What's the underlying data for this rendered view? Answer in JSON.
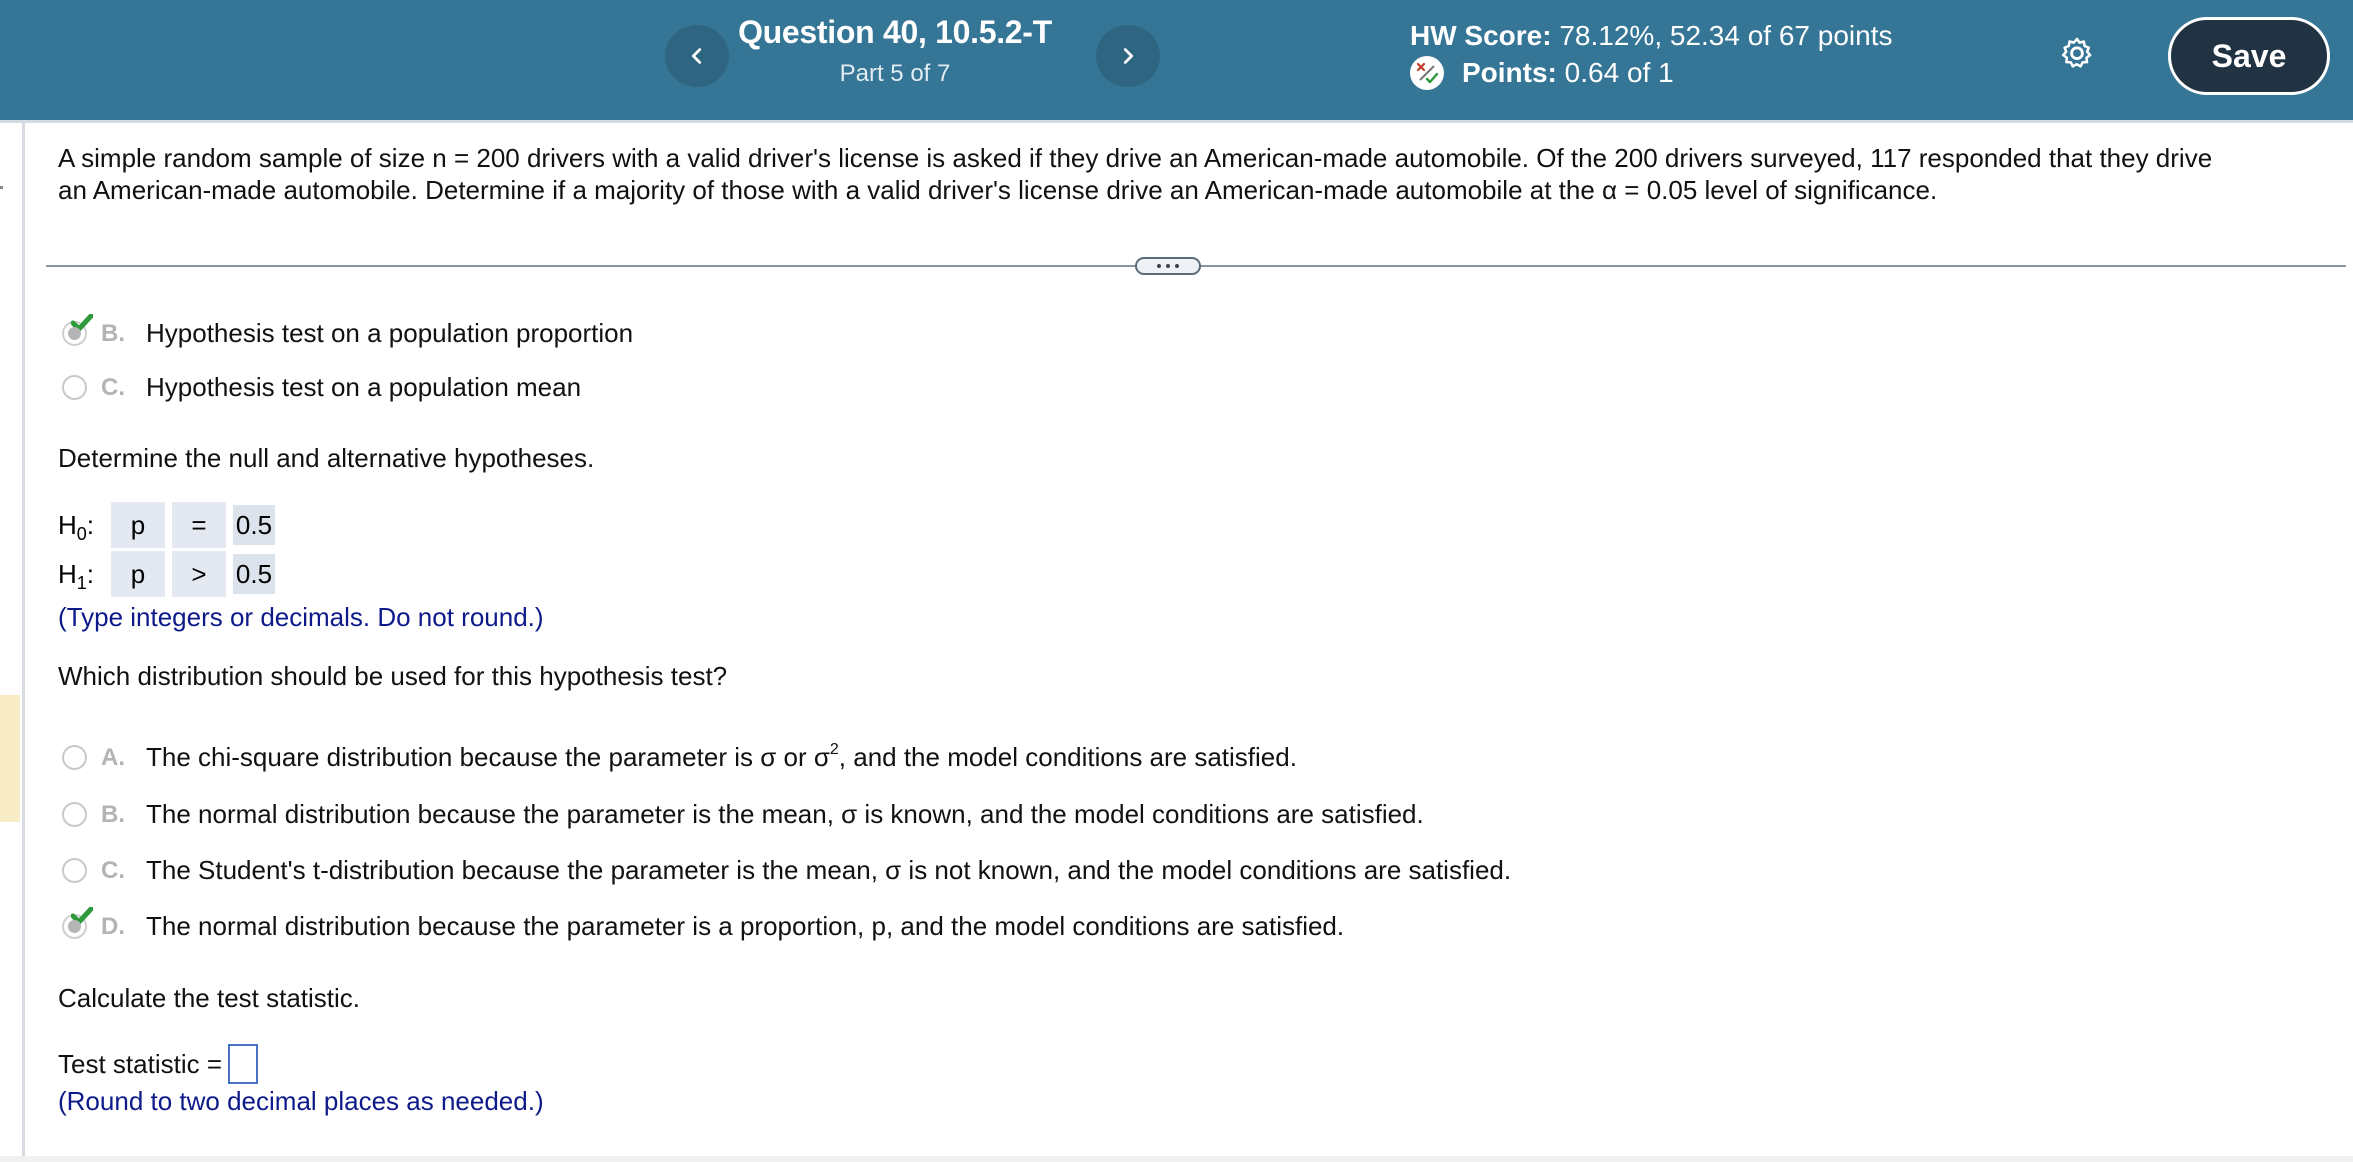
{
  "header": {
    "question_title": "Question 40, 10.5.2-T",
    "part": "Part 5 of 7",
    "hw_score_label": "HW Score:",
    "hw_score_value": "78.12%, 52.34 of 67 points",
    "points_label": "Points:",
    "points_value": "0.64 of 1",
    "save_label": "Save",
    "prev_icon": "chevron-left-icon",
    "next_icon": "chevron-right-icon",
    "settings_icon": "gear-icon",
    "points_status_icon": "partial-credit-icon"
  },
  "colors": {
    "header_bg": "#357596",
    "save_bg": "#213342",
    "hint_text": "#0e1a8a",
    "check_green": "#2e9a3b",
    "input_border": "#4a72c4"
  },
  "problem": {
    "line1": "A simple random sample of size n = 200 drivers with a valid driver's license is asked if they drive an American-made automobile. Of the 200 drivers surveyed, 117 responded that they drive",
    "line2": "an American-made automobile. Determine if a majority of those with a valid driver's license drive an American-made automobile at the α = 0.05 level of significance.",
    "more_button": "..."
  },
  "test_type": {
    "options": [
      {
        "letter": "B.",
        "text": "Hypothesis test on a population proportion",
        "selected": true,
        "correct": true
      },
      {
        "letter": "C.",
        "text": "Hypothesis test on a population mean",
        "selected": false,
        "correct": false
      }
    ]
  },
  "hypotheses": {
    "prompt": "Determine the null and alternative hypotheses.",
    "h0": {
      "label": "H",
      "sub": "0",
      "param": "p",
      "operator": "=",
      "value": "0.5"
    },
    "h1": {
      "label": "H",
      "sub": "1",
      "param": "p",
      "operator": ">",
      "value": "0.5"
    },
    "hint": "(Type integers or decimals. Do not round.)"
  },
  "distribution": {
    "prompt": "Which distribution should be used for this hypothesis test?",
    "options": [
      {
        "letter": "A.",
        "text_before": "The chi-square distribution because the parameter is σ or σ",
        "sup": "2",
        "text_after": ", and the model conditions are satisfied.",
        "selected": false
      },
      {
        "letter": "B.",
        "text": "The normal distribution because the parameter is the mean, σ is known, and the model conditions are satisfied.",
        "selected": false
      },
      {
        "letter": "C.",
        "text": "The Student's t-distribution because the parameter is the mean, σ is not known, and the model conditions are satisfied.",
        "selected": false
      },
      {
        "letter": "D.",
        "text": "The normal distribution because the parameter is a proportion, p, and the model conditions are satisfied.",
        "selected": true,
        "correct": true
      }
    ]
  },
  "test_statistic": {
    "prompt": "Calculate the test statistic.",
    "label": "Test statistic =",
    "value": "",
    "hint": "(Round to two decimal places as needed.)"
  }
}
